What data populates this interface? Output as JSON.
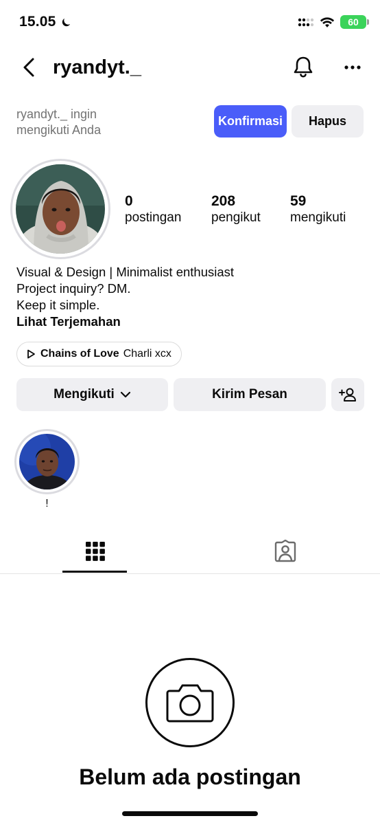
{
  "status_bar": {
    "time": "15.05",
    "battery": "60"
  },
  "header": {
    "username": "ryandyt._"
  },
  "follow_request": {
    "line1": "ryandyt._ ingin",
    "line2": "mengikuti Anda",
    "confirm_label": "Konfirmasi",
    "delete_label": "Hapus"
  },
  "stats": [
    {
      "value": "0",
      "label": "postingan"
    },
    {
      "value": "208",
      "label": "pengikut"
    },
    {
      "value": "59",
      "label": "mengikuti"
    }
  ],
  "bio": {
    "line1": "Visual & Design | Minimalist enthusiast",
    "line2": "Project inquiry? DM.",
    "line3": "Keep it simple.",
    "translate_label": "Lihat Terjemahan"
  },
  "music": {
    "title": "Chains of Love",
    "artist": "Charli xcx"
  },
  "actions": {
    "following_label": "Mengikuti",
    "message_label": "Kirim Pesan"
  },
  "highlight": {
    "label": "!"
  },
  "empty_state": {
    "title": "Belum ada postingan"
  },
  "icons": {
    "back": "chevron-left-icon",
    "bell": "bell-icon",
    "more": "more-horizontal-icon",
    "grid": "grid-icon",
    "tagged": "tagged-person-icon",
    "camera": "camera-icon",
    "add_user": "add-user-icon",
    "play": "play-icon"
  },
  "colors": {
    "accent": "#4a5df9",
    "button_bg": "#efeff2",
    "battery": "#3bd35a"
  }
}
